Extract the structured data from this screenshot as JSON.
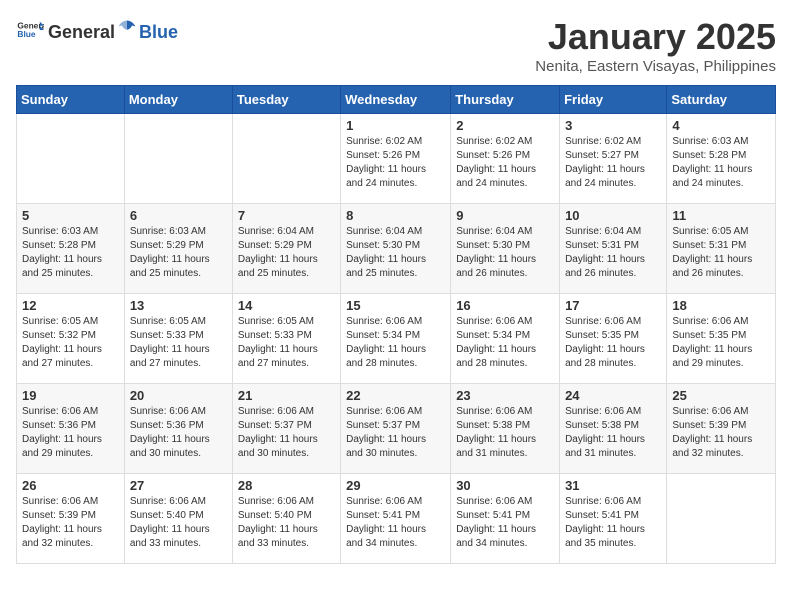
{
  "header": {
    "logo_general": "General",
    "logo_blue": "Blue",
    "month": "January 2025",
    "location": "Nenita, Eastern Visayas, Philippines"
  },
  "weekdays": [
    "Sunday",
    "Monday",
    "Tuesday",
    "Wednesday",
    "Thursday",
    "Friday",
    "Saturday"
  ],
  "weeks": [
    [
      {
        "day": "",
        "sunrise": "",
        "sunset": "",
        "daylight": ""
      },
      {
        "day": "",
        "sunrise": "",
        "sunset": "",
        "daylight": ""
      },
      {
        "day": "",
        "sunrise": "",
        "sunset": "",
        "daylight": ""
      },
      {
        "day": "1",
        "sunrise": "Sunrise: 6:02 AM",
        "sunset": "Sunset: 5:26 PM",
        "daylight": "Daylight: 11 hours and 24 minutes."
      },
      {
        "day": "2",
        "sunrise": "Sunrise: 6:02 AM",
        "sunset": "Sunset: 5:26 PM",
        "daylight": "Daylight: 11 hours and 24 minutes."
      },
      {
        "day": "3",
        "sunrise": "Sunrise: 6:02 AM",
        "sunset": "Sunset: 5:27 PM",
        "daylight": "Daylight: 11 hours and 24 minutes."
      },
      {
        "day": "4",
        "sunrise": "Sunrise: 6:03 AM",
        "sunset": "Sunset: 5:28 PM",
        "daylight": "Daylight: 11 hours and 24 minutes."
      }
    ],
    [
      {
        "day": "5",
        "sunrise": "Sunrise: 6:03 AM",
        "sunset": "Sunset: 5:28 PM",
        "daylight": "Daylight: 11 hours and 25 minutes."
      },
      {
        "day": "6",
        "sunrise": "Sunrise: 6:03 AM",
        "sunset": "Sunset: 5:29 PM",
        "daylight": "Daylight: 11 hours and 25 minutes."
      },
      {
        "day": "7",
        "sunrise": "Sunrise: 6:04 AM",
        "sunset": "Sunset: 5:29 PM",
        "daylight": "Daylight: 11 hours and 25 minutes."
      },
      {
        "day": "8",
        "sunrise": "Sunrise: 6:04 AM",
        "sunset": "Sunset: 5:30 PM",
        "daylight": "Daylight: 11 hours and 25 minutes."
      },
      {
        "day": "9",
        "sunrise": "Sunrise: 6:04 AM",
        "sunset": "Sunset: 5:30 PM",
        "daylight": "Daylight: 11 hours and 26 minutes."
      },
      {
        "day": "10",
        "sunrise": "Sunrise: 6:04 AM",
        "sunset": "Sunset: 5:31 PM",
        "daylight": "Daylight: 11 hours and 26 minutes."
      },
      {
        "day": "11",
        "sunrise": "Sunrise: 6:05 AM",
        "sunset": "Sunset: 5:31 PM",
        "daylight": "Daylight: 11 hours and 26 minutes."
      }
    ],
    [
      {
        "day": "12",
        "sunrise": "Sunrise: 6:05 AM",
        "sunset": "Sunset: 5:32 PM",
        "daylight": "Daylight: 11 hours and 27 minutes."
      },
      {
        "day": "13",
        "sunrise": "Sunrise: 6:05 AM",
        "sunset": "Sunset: 5:33 PM",
        "daylight": "Daylight: 11 hours and 27 minutes."
      },
      {
        "day": "14",
        "sunrise": "Sunrise: 6:05 AM",
        "sunset": "Sunset: 5:33 PM",
        "daylight": "Daylight: 11 hours and 27 minutes."
      },
      {
        "day": "15",
        "sunrise": "Sunrise: 6:06 AM",
        "sunset": "Sunset: 5:34 PM",
        "daylight": "Daylight: 11 hours and 28 minutes."
      },
      {
        "day": "16",
        "sunrise": "Sunrise: 6:06 AM",
        "sunset": "Sunset: 5:34 PM",
        "daylight": "Daylight: 11 hours and 28 minutes."
      },
      {
        "day": "17",
        "sunrise": "Sunrise: 6:06 AM",
        "sunset": "Sunset: 5:35 PM",
        "daylight": "Daylight: 11 hours and 28 minutes."
      },
      {
        "day": "18",
        "sunrise": "Sunrise: 6:06 AM",
        "sunset": "Sunset: 5:35 PM",
        "daylight": "Daylight: 11 hours and 29 minutes."
      }
    ],
    [
      {
        "day": "19",
        "sunrise": "Sunrise: 6:06 AM",
        "sunset": "Sunset: 5:36 PM",
        "daylight": "Daylight: 11 hours and 29 minutes."
      },
      {
        "day": "20",
        "sunrise": "Sunrise: 6:06 AM",
        "sunset": "Sunset: 5:36 PM",
        "daylight": "Daylight: 11 hours and 30 minutes."
      },
      {
        "day": "21",
        "sunrise": "Sunrise: 6:06 AM",
        "sunset": "Sunset: 5:37 PM",
        "daylight": "Daylight: 11 hours and 30 minutes."
      },
      {
        "day": "22",
        "sunrise": "Sunrise: 6:06 AM",
        "sunset": "Sunset: 5:37 PM",
        "daylight": "Daylight: 11 hours and 30 minutes."
      },
      {
        "day": "23",
        "sunrise": "Sunrise: 6:06 AM",
        "sunset": "Sunset: 5:38 PM",
        "daylight": "Daylight: 11 hours and 31 minutes."
      },
      {
        "day": "24",
        "sunrise": "Sunrise: 6:06 AM",
        "sunset": "Sunset: 5:38 PM",
        "daylight": "Daylight: 11 hours and 31 minutes."
      },
      {
        "day": "25",
        "sunrise": "Sunrise: 6:06 AM",
        "sunset": "Sunset: 5:39 PM",
        "daylight": "Daylight: 11 hours and 32 minutes."
      }
    ],
    [
      {
        "day": "26",
        "sunrise": "Sunrise: 6:06 AM",
        "sunset": "Sunset: 5:39 PM",
        "daylight": "Daylight: 11 hours and 32 minutes."
      },
      {
        "day": "27",
        "sunrise": "Sunrise: 6:06 AM",
        "sunset": "Sunset: 5:40 PM",
        "daylight": "Daylight: 11 hours and 33 minutes."
      },
      {
        "day": "28",
        "sunrise": "Sunrise: 6:06 AM",
        "sunset": "Sunset: 5:40 PM",
        "daylight": "Daylight: 11 hours and 33 minutes."
      },
      {
        "day": "29",
        "sunrise": "Sunrise: 6:06 AM",
        "sunset": "Sunset: 5:41 PM",
        "daylight": "Daylight: 11 hours and 34 minutes."
      },
      {
        "day": "30",
        "sunrise": "Sunrise: 6:06 AM",
        "sunset": "Sunset: 5:41 PM",
        "daylight": "Daylight: 11 hours and 34 minutes."
      },
      {
        "day": "31",
        "sunrise": "Sunrise: 6:06 AM",
        "sunset": "Sunset: 5:41 PM",
        "daylight": "Daylight: 11 hours and 35 minutes."
      },
      {
        "day": "",
        "sunrise": "",
        "sunset": "",
        "daylight": ""
      }
    ]
  ]
}
